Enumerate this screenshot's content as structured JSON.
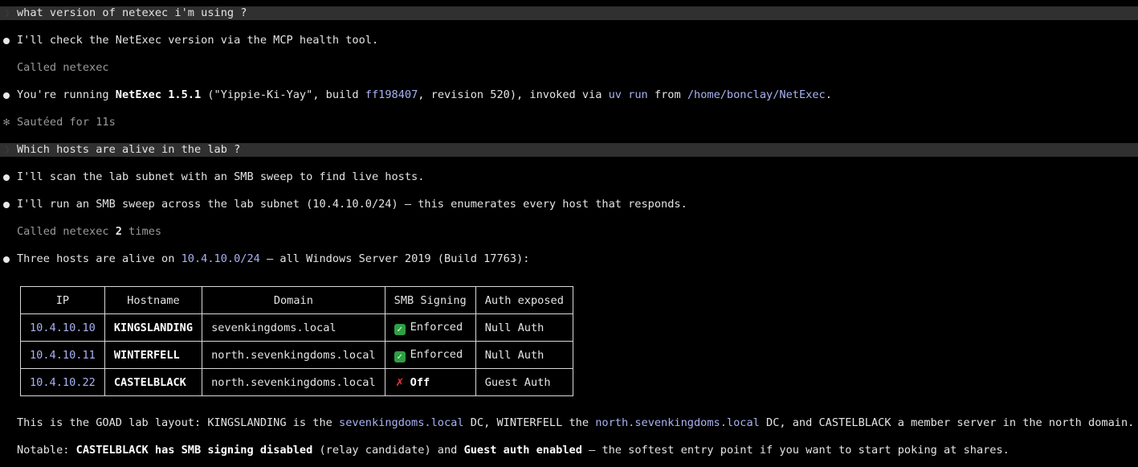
{
  "colors": {
    "background": "#000000",
    "prompt_bar": "#303030",
    "highlight": "#a9b2f2",
    "enforced_check": "#2ea043",
    "off_cross": "#e53935"
  },
  "conversation": {
    "q1": {
      "prompt": "what version of netexec i'm using ?"
    },
    "a1": {
      "intro": "I'll check the NetExec version via the MCP health tool.",
      "tool_call": "Called netexec",
      "result": {
        "p1": "You're running ",
        "product": "NetExec 1.5.1",
        "p2": " (\"Yippie-Ki-Yay\", build ",
        "build": "ff198407",
        "p3": ", revision 520), invoked via ",
        "cmd": "uv run",
        "p4": " from ",
        "path": "/home/bonclay/NetExec",
        "p5": "."
      },
      "timer": "Sautéed for 11s"
    },
    "q2": {
      "prompt": "Which hosts are alive in the lab ?"
    },
    "a2": {
      "intro1": "I'll scan the lab subnet with an SMB sweep to find live hosts.",
      "intro2": "I'll run an SMB sweep across the lab subnet (10.4.10.0/24) — this enumerates every host that responds.",
      "tool_call_prefix": "Called netexec ",
      "tool_call_count": "2",
      "tool_call_suffix": " times",
      "summary_p1": "Three hosts are alive on ",
      "summary_subnet": "10.4.10.0/24",
      "summary_p2": " — all Windows Server 2019 (Build 17763):",
      "table": {
        "headers": {
          "ip": "IP",
          "hostname": "Hostname",
          "domain": "Domain",
          "smb_signing": "SMB Signing",
          "auth": "Auth exposed"
        },
        "rows": [
          {
            "ip": "10.4.10.10",
            "hostname": "KINGSLANDING",
            "domain": "sevenkingdoms.local",
            "signing": "Enforced",
            "signing_icon": "check-icon",
            "auth": "Null Auth"
          },
          {
            "ip": "10.4.10.11",
            "hostname": "WINTERFELL",
            "domain": "north.sevenkingdoms.local",
            "signing": "Enforced",
            "signing_icon": "check-icon",
            "auth": "Null Auth"
          },
          {
            "ip": "10.4.10.22",
            "hostname": "CASTELBLACK",
            "domain": "north.sevenkingdoms.local",
            "signing": "Off",
            "signing_icon": "cross-icon",
            "auth": "Guest Auth"
          }
        ]
      },
      "layout_note": {
        "p1": "This is the GOAD lab layout: KINGSLANDING is the ",
        "d1": "sevenkingdoms.local",
        "p2": " DC, WINTERFELL the ",
        "d2": "north.sevenkingdoms.local",
        "p3": " DC, and CASTELBLACK a member server in the north domain."
      },
      "notable": {
        "p1": "Notable: ",
        "b1": "CASTELBLACK has SMB signing disabled",
        "p2": " (relay candidate) and ",
        "b2": "Guest auth enabled",
        "p3": " — the softest entry point if you want to start poking at shares."
      }
    }
  },
  "icons": {
    "prompt_chevron": "❯",
    "bullet": "●",
    "timer_star": "✻",
    "check": "✓",
    "cross": "✗"
  }
}
